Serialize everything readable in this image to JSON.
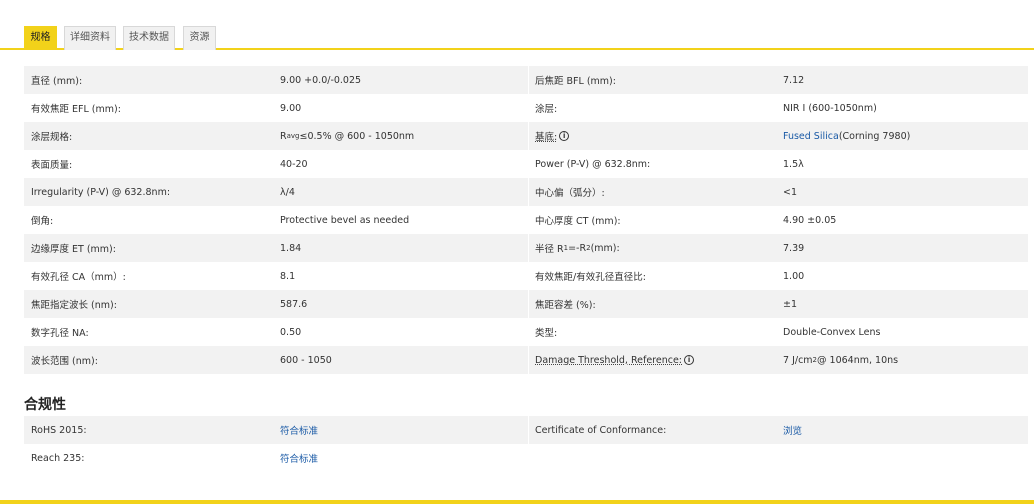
{
  "tabs": [
    {
      "label": "规格",
      "active": true
    },
    {
      "label": "详细资料",
      "active": false
    },
    {
      "label": "技术数据",
      "active": false
    },
    {
      "label": "资源",
      "active": false
    }
  ],
  "specs": [
    {
      "l1": "直径 (mm):",
      "v1": "9.00 +0.0/-0.025",
      "l2": "后焦距 BFL (mm):",
      "v2": "7.12"
    },
    {
      "l1": "有效焦距 EFL (mm):",
      "v1": "9.00",
      "l2": "涂层:",
      "v2": "NIR I (600-1050nm)"
    },
    {
      "l1": "涂层规格:",
      "v1_pre": "R",
      "v1_sub": "avg",
      "v1_post": " ≤0.5% @ 600 - 1050nm",
      "l2": "基底:",
      "v2_link": "Fused Silica",
      "v2_post": " (Corning 7980)"
    },
    {
      "l1": "表面质量:",
      "v1": "40-20",
      "l2": "Power (P-V) @ 632.8nm:",
      "v2": "1.5λ"
    },
    {
      "l1": "Irregularity (P-V) @ 632.8nm:",
      "v1": "λ/4",
      "l2": "中心偏（弧分）:",
      "v2": "<1"
    },
    {
      "l1": "倒角:",
      "v1": "Protective bevel as needed",
      "l2": "中心厚度 CT (mm):",
      "v2": "4.90 ±0.05"
    },
    {
      "l1": "边缘厚度 ET (mm):",
      "v1": "1.84",
      "l2_pre": "半径 R",
      "l2_sub1": "1",
      "l2_mid": "=-R",
      "l2_sub2": "2",
      "l2_post": " (mm):",
      "v2": "7.39"
    },
    {
      "l1": "有效孔径 CA（mm）:",
      "v1": "8.1",
      "l2": "有效焦距/有效孔径直径比:",
      "v2": "1.00"
    },
    {
      "l1": "焦距指定波长 (nm):",
      "v1": "587.6",
      "l2": "焦距容差 (%):",
      "v2": "±1"
    },
    {
      "l1": "数字孔径 NA:",
      "v1": "0.50",
      "l2": "类型:",
      "v2": "Double-Convex Lens"
    },
    {
      "l1": "波长范围 (nm):",
      "v1": "600 - 1050",
      "l2": "Damage Threshold, Reference:",
      "v2_pre": "7 J/cm",
      "v2_sup": "2",
      "v2_post": " @ 1064nm, 10ns"
    }
  ],
  "info_glyph": "i",
  "compliance": {
    "title": "合规性",
    "rows": [
      {
        "l1": "RoHS 2015:",
        "v1": "符合标准",
        "l2": "Certificate of Conformance:",
        "v2": "浏览"
      },
      {
        "l1": "Reach 235:",
        "v1": "符合标准"
      }
    ]
  },
  "colors": {
    "accent": "#f2d21a",
    "link": "#1a5aa6",
    "row_shade": "#f2f2f2"
  }
}
